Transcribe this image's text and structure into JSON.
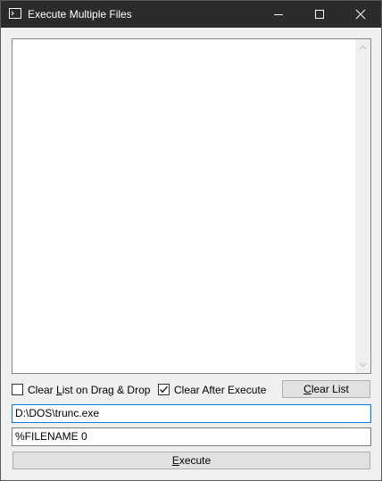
{
  "window": {
    "title": "Execute Multiple Files"
  },
  "listbox": {
    "items": []
  },
  "options": {
    "clear_on_drop": {
      "label_pre": "Clear ",
      "label_ul": "L",
      "label_post": "ist on Drag & Drop",
      "checked": false
    },
    "clear_after_execute": {
      "label": "Clear After Execute",
      "checked": true
    }
  },
  "buttons": {
    "clear_list_ul": "C",
    "clear_list_rest": "lear List",
    "execute_ul": "E",
    "execute_rest": "xecute"
  },
  "fields": {
    "executable": "D:\\DOS\\trunc.exe",
    "arguments": "%FILENAME 0"
  },
  "icons": {
    "app": "console-icon",
    "minimize": "minimize-icon",
    "maximize": "maximize-icon",
    "close": "close-icon",
    "check": "checkmark-icon"
  },
  "colors": {
    "titlebar": "#2b2b2b",
    "focus_border": "#0078d7"
  }
}
